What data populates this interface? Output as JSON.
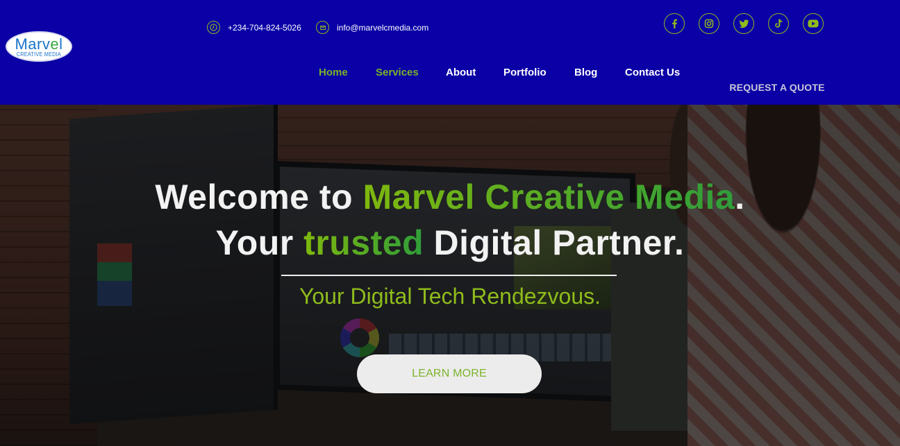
{
  "brand": {
    "logo_word_main": "Marv",
    "logo_word_accent": "e",
    "logo_word_end": "l",
    "logo_subtitle": "CREATIVE MEDIA"
  },
  "contact": {
    "phone": "+234-704-824-5026",
    "phone_icon": "clock-icon",
    "email": "info@marvelcmedia.com",
    "email_icon": "envelope-icon"
  },
  "socials": [
    {
      "icon": "facebook-icon",
      "glyph": "f"
    },
    {
      "icon": "instagram-icon",
      "glyph": ""
    },
    {
      "icon": "twitter-icon",
      "glyph": ""
    },
    {
      "icon": "tiktok-icon",
      "glyph": ""
    },
    {
      "icon": "youtube-icon",
      "glyph": ""
    }
  ],
  "nav": {
    "items": [
      {
        "label": "Home",
        "active": true
      },
      {
        "label": "Services",
        "active": true
      },
      {
        "label": "About",
        "active": false
      },
      {
        "label": "Portfolio",
        "active": false
      },
      {
        "label": "Blog",
        "active": false
      },
      {
        "label": "Contact Us",
        "active": false
      }
    ],
    "quote_label": "REQUEST A QUOTE"
  },
  "hero": {
    "line1_pre": "Welcome to ",
    "line1_highlight": "Marvel Creative Media",
    "line1_post": ".",
    "line2_pre": "Your ",
    "line2_highlight": "trusted",
    "line2_post": " Digital Partner.",
    "tagline": "Your Digital Tech Rendezvous.",
    "cta_label": "LEARN MORE"
  },
  "colors": {
    "header_bg": "#0a00a6",
    "accent_green": "#7cb32a",
    "text_light": "#f2f2f2"
  }
}
